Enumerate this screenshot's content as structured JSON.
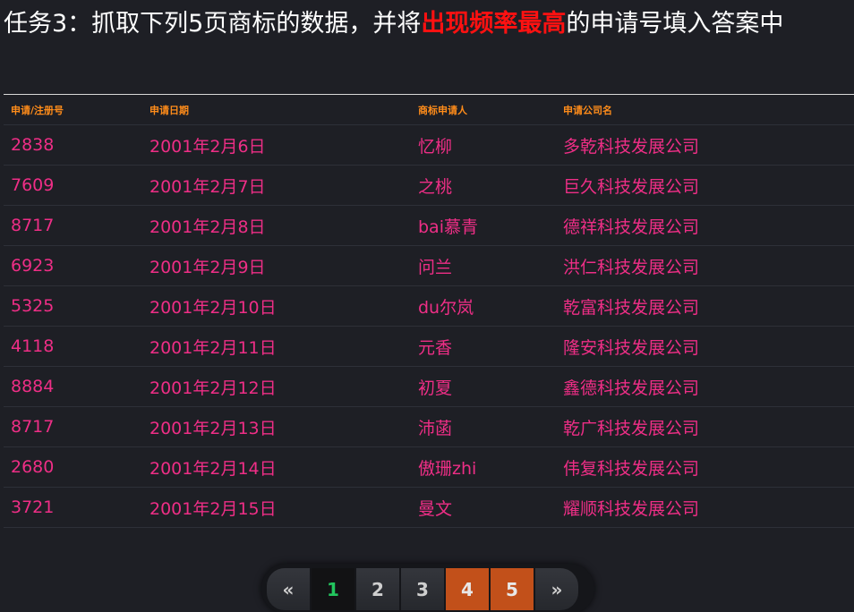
{
  "task": {
    "prefix": "任务3：抓取下列5页商标的数据，并将",
    "highlight": "出现频率最高",
    "suffix": "的申请号填入答案中"
  },
  "table": {
    "headers": [
      "申请/注册号",
      "申请日期",
      "商标申请人",
      "申请公司名"
    ],
    "rows": [
      [
        "2838",
        "2001年2月6日",
        "忆柳",
        "多乾科技发展公司"
      ],
      [
        "7609",
        "2001年2月7日",
        "之桃",
        "巨久科技发展公司"
      ],
      [
        "8717",
        "2001年2月8日",
        "bai慕青",
        "德祥科技发展公司"
      ],
      [
        "6923",
        "2001年2月9日",
        "问兰",
        "洪仁科技发展公司"
      ],
      [
        "5325",
        "2001年2月10日",
        "du尔岚",
        "乾富科技发展公司"
      ],
      [
        "4118",
        "2001年2月11日",
        "元香",
        "隆安科技发展公司"
      ],
      [
        "8884",
        "2001年2月12日",
        "初夏",
        "鑫德科技发展公司"
      ],
      [
        "8717",
        "2001年2月13日",
        "沛菡",
        "乾广科技发展公司"
      ],
      [
        "2680",
        "2001年2月14日",
        "傲珊zhi",
        "伟复科技发展公司"
      ],
      [
        "3721",
        "2001年2月15日",
        "曼文",
        "耀顺科技发展公司"
      ]
    ]
  },
  "pagination": {
    "prev": "«",
    "next": "»",
    "pages": [
      "1",
      "2",
      "3",
      "4",
      "5"
    ],
    "current_page": "1",
    "highlighted_pages": [
      "4",
      "5"
    ]
  },
  "colors": {
    "background": "#1e1f25",
    "title": "#ffffff",
    "title_highlight": "#ff1111",
    "header": "#ff8c1a",
    "cell": "#ee2e86",
    "current_page": "#22c55e",
    "highlight_page": "#c2501a"
  }
}
